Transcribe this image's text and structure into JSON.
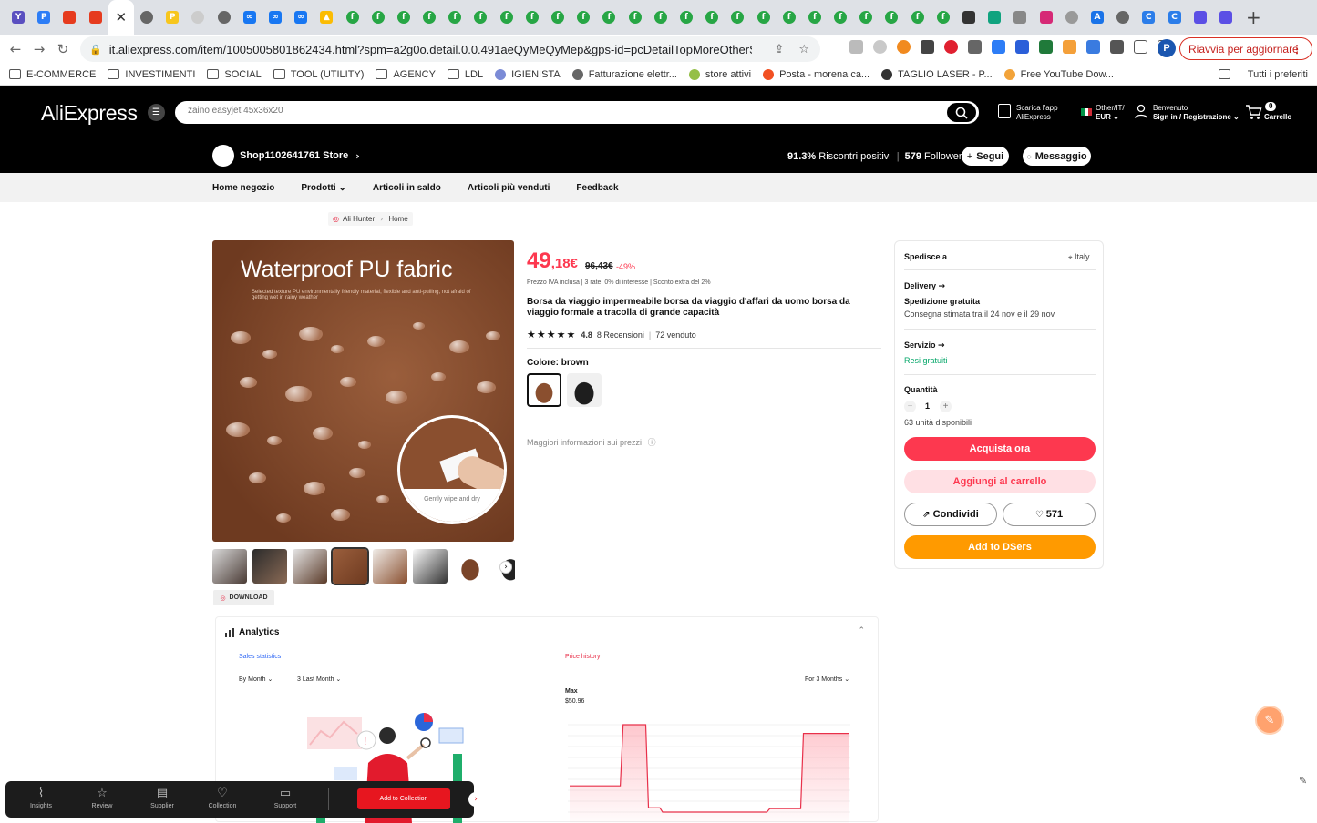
{
  "browser": {
    "tabs": [
      {
        "icon": "y-icon",
        "color": "#5a4fc0",
        "glyph": "Y"
      },
      {
        "icon": "p-blue-icon",
        "color": "#2d7df6",
        "glyph": "P"
      },
      {
        "icon": "red-bag-icon",
        "color": "#e63b1e",
        "glyph": ""
      },
      {
        "icon": "red-bag-icon",
        "color": "#e63b1e",
        "glyph": ""
      },
      {
        "icon": "close-icon",
        "color": "#ffffff",
        "glyph": "",
        "active": true
      },
      {
        "icon": "globe-icon",
        "color": "#666666",
        "glyph": ""
      },
      {
        "icon": "p-yellow-icon",
        "color": "#f7c61d",
        "glyph": "P"
      },
      {
        "icon": "blank-icon",
        "color": "#cccccc",
        "glyph": ""
      },
      {
        "icon": "globe-icon",
        "color": "#666666",
        "glyph": ""
      },
      {
        "icon": "meta-icon",
        "color": "#1877f2",
        "glyph": "∞"
      },
      {
        "icon": "meta-icon",
        "color": "#1877f2",
        "glyph": "∞"
      },
      {
        "icon": "meta-icon",
        "color": "#1877f2",
        "glyph": "∞"
      },
      {
        "icon": "ads-icon",
        "color": "#fbbc04",
        "glyph": "▲"
      },
      {
        "icon": "green-f-icon",
        "color": "#27a645",
        "glyph": "f"
      },
      {
        "icon": "green-f-icon",
        "color": "#27a645",
        "glyph": "f"
      },
      {
        "icon": "green-f-icon",
        "color": "#27a645",
        "glyph": "f"
      },
      {
        "icon": "green-f-icon",
        "color": "#27a645",
        "glyph": "f"
      },
      {
        "icon": "green-f-icon",
        "color": "#27a645",
        "glyph": "f"
      },
      {
        "icon": "green-f-icon",
        "color": "#27a645",
        "glyph": "f"
      },
      {
        "icon": "green-f-icon",
        "color": "#27a645",
        "glyph": "f"
      },
      {
        "icon": "green-f-icon",
        "color": "#27a645",
        "glyph": "f"
      },
      {
        "icon": "green-f-icon",
        "color": "#27a645",
        "glyph": "f"
      },
      {
        "icon": "green-f-icon",
        "color": "#27a645",
        "glyph": "f"
      },
      {
        "icon": "green-f-icon",
        "color": "#27a645",
        "glyph": "f"
      },
      {
        "icon": "green-f-icon",
        "color": "#27a645",
        "glyph": "f"
      },
      {
        "icon": "green-f-icon",
        "color": "#27a645",
        "glyph": "f"
      },
      {
        "icon": "green-f-icon",
        "color": "#27a645",
        "glyph": "f"
      },
      {
        "icon": "green-f-icon",
        "color": "#27a645",
        "glyph": "f"
      },
      {
        "icon": "green-f-icon",
        "color": "#27a645",
        "glyph": "f"
      },
      {
        "icon": "green-f-icon",
        "color": "#27a645",
        "glyph": "f"
      },
      {
        "icon": "green-f-icon",
        "color": "#27a645",
        "glyph": "f"
      },
      {
        "icon": "green-f-icon",
        "color": "#27a645",
        "glyph": "f"
      },
      {
        "icon": "green-f-icon",
        "color": "#27a645",
        "glyph": "f"
      },
      {
        "icon": "green-f-icon",
        "color": "#27a645",
        "glyph": "f"
      },
      {
        "icon": "green-f-icon",
        "color": "#27a645",
        "glyph": "f"
      },
      {
        "icon": "green-f-icon",
        "color": "#27a645",
        "glyph": "f"
      },
      {
        "icon": "green-f-icon",
        "color": "#27a645",
        "glyph": "f"
      },
      {
        "icon": "dark-circle-icon",
        "color": "#333333",
        "glyph": ""
      },
      {
        "icon": "chatgpt-icon",
        "color": "#10a37f",
        "glyph": ""
      },
      {
        "icon": "person-icon",
        "color": "#888888",
        "glyph": ""
      },
      {
        "icon": "instagram-icon",
        "color": "#d62976",
        "glyph": ""
      },
      {
        "icon": "globe-icon",
        "color": "#999999",
        "glyph": ""
      },
      {
        "icon": "a-blue-icon",
        "color": "#1a73e8",
        "glyph": "A"
      },
      {
        "icon": "globe-icon",
        "color": "#666666",
        "glyph": ""
      },
      {
        "icon": "c-blue-icon",
        "color": "#2b7de9",
        "glyph": "C"
      },
      {
        "icon": "c-blue-icon",
        "color": "#2b7de9",
        "glyph": "C"
      },
      {
        "icon": "chat-purple-icon",
        "color": "#5b4fe5",
        "glyph": ""
      },
      {
        "icon": "chat-purple-icon",
        "color": "#5b4fe5",
        "glyph": ""
      }
    ],
    "new_tab": "+",
    "url": "it.aliexpress.com/item/1005005801862434.html?spm=a2g0o.detail.0.0.491aeQyMeQyMep&gps-id=pcDetailTopMoreOtherSeller&...",
    "profile_initial": "P",
    "restart_label": "Riavvia per aggiornare",
    "bookmarks": [
      {
        "label": "E-COMMERCE",
        "type": "folder"
      },
      {
        "label": "INVESTIMENTI",
        "type": "folder"
      },
      {
        "label": "SOCIAL",
        "type": "folder"
      },
      {
        "label": "TOOL (UTILITY)",
        "type": "folder"
      },
      {
        "label": "AGENCY",
        "type": "folder"
      },
      {
        "label": "LDL",
        "type": "folder"
      },
      {
        "label": "IGIENISTA",
        "type": "site",
        "color": "#7b8bd6"
      },
      {
        "label": "Fatturazione elettr...",
        "type": "site",
        "color": "#666666"
      },
      {
        "label": "store attivi",
        "type": "site",
        "color": "#95bf47"
      },
      {
        "label": "Posta - morena ca...",
        "type": "site",
        "color": "#f25022"
      },
      {
        "label": "TAGLIO LASER - P...",
        "type": "site",
        "color": "#333333"
      },
      {
        "label": "Free YouTube Dow...",
        "type": "site",
        "color": "#f2a33a"
      }
    ],
    "all_bookmarks": "Tutti i preferiti"
  },
  "header": {
    "logo": "AliExpress",
    "search_placeholder": "zaino easyjet 45x36x20",
    "app_line1": "Scarica l'app",
    "app_line2": "AliExpress",
    "region_line1": "Other/IT/",
    "region_line2": "EUR",
    "account_line1": "Benvenuto",
    "account_line2": "Sign in / Registrazione",
    "cart_count": "0",
    "cart_label": "Carrello"
  },
  "store": {
    "name": "Shop1102641761 Store",
    "feedback_pct": "91.3%",
    "feedback_label": "Riscontri positivi",
    "followers": "579",
    "followers_label": "Follower",
    "follow_btn": "Segui",
    "message_btn": "Messaggio",
    "nav": [
      "Home negozio",
      "Prodotti",
      "Articoli in saldo",
      "Articoli più venduti",
      "Feedback"
    ]
  },
  "breadcrumb": [
    "Ali Hunter",
    "Home"
  ],
  "gallery": {
    "headline": "Waterproof PU fabric",
    "subtext": "Selected texture PU environmentally friendly material, flexible and anti-pulling, not afraid of getting wet in rainy weather",
    "zoom_caption": "Gently wipe and dry",
    "download_label": "DOWNLOAD"
  },
  "product": {
    "price_int": "49",
    "price_dec": ",18€",
    "old_price": "96,43€",
    "discount": "-49%",
    "price_info": "Prezzo IVA inclusa  |  3 rate, 0% di interesse  |  Sconto extra del 2%",
    "title": "Borsa da viaggio impermeabile borsa da viaggio d'affari da uomo borsa da viaggio formale a tracolla di grande capacità",
    "stars": "★★★★★",
    "rating": "4.8",
    "reviews": "8 Recensioni",
    "sold": "72 venduto",
    "color_label": "Colore: brown",
    "more_price_info": "Maggiori informazioni sui prezzi"
  },
  "buybox": {
    "ship_to": "Spedisce a",
    "country": "Italy",
    "delivery": "Delivery",
    "free_shipping": "Spedizione gratuita",
    "estimate": "Consegna stimata tra il 24 nov e il 29 nov",
    "service": "Servizio",
    "free_returns": "Resi gratuiti",
    "quantity_label": "Quantità",
    "quantity_value": "1",
    "available": "63 unità disponibili",
    "buy_now": "Acquista ora",
    "add_cart": "Aggiungi al carrello",
    "share": "Condividi",
    "wishlist_count": "571",
    "dsers": "Add to DSers"
  },
  "analytics": {
    "title": "Analytics",
    "sales_tab": "Sales statistics",
    "price_tab": "Price history",
    "by_month": "By Month",
    "last_month": "3 Last Month",
    "for_months": "For 3 Months",
    "max_label": "Max",
    "max_value": "$50.96"
  },
  "chart_data": {
    "type": "line",
    "title": "Price history",
    "ylabel": "",
    "series": [
      {
        "values": [
          0.3,
          0.3,
          0.3,
          0.3,
          0.3,
          0.3,
          0.3,
          0.3,
          0.3,
          0.3,
          0.3,
          0.3,
          0.3,
          0.3,
          0.3,
          0.3,
          0.3,
          0.3,
          0.3,
          1,
          1,
          1,
          1,
          1,
          1,
          1,
          1,
          1,
          0.05,
          0.05,
          0.05,
          0.05,
          0.05,
          0,
          0,
          0,
          0,
          0,
          0,
          0,
          0,
          0,
          0,
          0,
          0,
          0,
          0,
          0,
          0,
          0,
          0,
          0,
          0,
          0,
          0,
          0,
          0,
          0,
          0,
          0,
          0,
          0,
          0,
          0,
          0,
          0,
          0,
          0,
          0,
          0,
          0,
          0.04,
          0.04,
          0.04,
          0.04,
          0.04,
          0.04,
          0.04,
          0.04,
          0.04,
          0.04,
          0.04,
          0.04,
          0.9,
          0.9,
          0.9,
          0.9,
          0.9,
          0.9,
          0.9,
          0.9,
          0.9,
          0.9,
          0.9,
          0.9,
          0.9,
          0.9,
          0.9,
          0.9,
          0.9
        ]
      }
    ]
  },
  "bottombar": {
    "items": [
      "Insights",
      "Review",
      "Supplier",
      "Collection",
      "Support"
    ],
    "add_collection": "Add to Collection"
  }
}
